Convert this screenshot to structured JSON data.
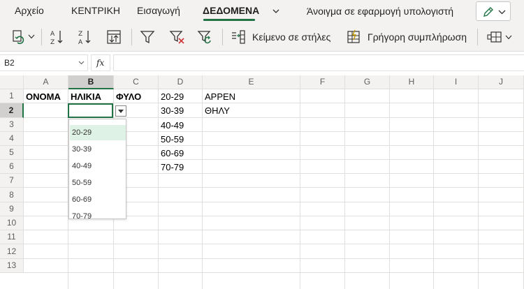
{
  "menu": {
    "tabs": [
      "Αρχείο",
      "ΚΕΝΤΡΙΚΗ",
      "Εισαγωγή",
      "ΔΕΔΟΜΕΝΑ"
    ],
    "active_tab": "ΔΕΔΟΜΕΝΑ",
    "open_in_app": "Άνοιγμα σε εφαρμογή υπολογιστή"
  },
  "ribbon": {
    "text_to_columns": "Κείμενο σε στήλες",
    "flash_fill": "Γρήγορη συμπλήρωση"
  },
  "formula_bar": {
    "name_box": "B2",
    "fx": "fx",
    "value": ""
  },
  "sheet": {
    "columns": [
      "A",
      "B",
      "C",
      "D",
      "E",
      "F",
      "G",
      "H",
      "I",
      "J"
    ],
    "selected_column": "B",
    "rows": [
      "1",
      "2",
      "3",
      "4",
      "5",
      "6",
      "7",
      "8",
      "9",
      "10",
      "11",
      "12",
      "13"
    ],
    "selected_row": "2",
    "cells": {
      "A1": "ΟΝΟΜΑ",
      "B1": "ΗΛΙΚΙΑ",
      "C1": "ΦΥΛΟ",
      "D1": "20-29",
      "E1": "ΑΡΡΕΝ",
      "D2": "30-39",
      "E2": "ΘΗΛΥ",
      "D3": "40-49",
      "D4": "50-59",
      "D5": "60-69",
      "D6": "70-79"
    }
  },
  "dropdown": {
    "options": [
      "20-29",
      "30-39",
      "40-49",
      "50-59",
      "60-69",
      "70-79"
    ],
    "highlighted": "20-29"
  },
  "colors": {
    "accent": "#217346",
    "highlight": "#dff2e6",
    "ribbon_bg": "#f3f2f1",
    "filter_clear": "#d13438"
  }
}
